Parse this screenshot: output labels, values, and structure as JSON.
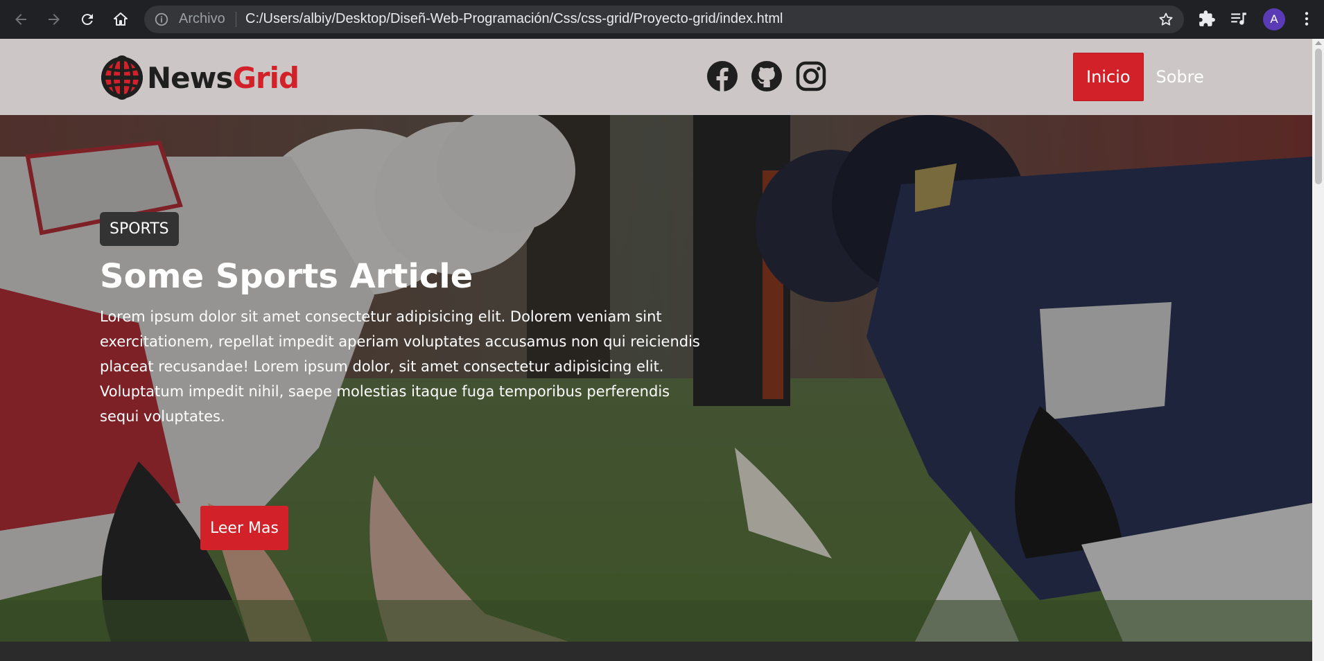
{
  "browser": {
    "scheme_label": "Archivo",
    "url": "C:/Users/albiy/Desktop/Diseñ-Web-Programación/Css/css-grid/Proyecto-grid/index.html",
    "avatar_letter": "A",
    "icons": [
      "back-icon",
      "forward-icon",
      "reload-icon",
      "home-icon",
      "info-icon",
      "bookmark-star-icon",
      "extensions-icon",
      "media-queue-icon",
      "menu-kebab-icon"
    ]
  },
  "header": {
    "logo_main": "News",
    "logo_accent": "Grid",
    "socials": [
      "facebook-icon",
      "github-icon",
      "instagram-icon"
    ],
    "nav": [
      {
        "label": "Inicio",
        "active": true
      },
      {
        "label": "Sobre",
        "active": false
      }
    ]
  },
  "hero": {
    "category": "SPORTS",
    "title": "Some Sports Article",
    "body": "Lorem ipsum dolor sit amet consectetur adipisicing elit. Dolorem veniam sint exercitationem, repellat impedit aperiam voluptates accusamus non qui reiciendis placeat recusandae! Lorem ipsum dolor, sit amet consectetur adipisicing elit. Voluptatum impedit nihil, saepe molestias itaque fuga temporibus perferendis sequi voluptates.",
    "cta": "Leer Mas"
  },
  "colors": {
    "brand_red": "#d22128",
    "header_bg": "#ccc7c6",
    "badge_bg": "#333333",
    "chrome_bg": "#202124"
  }
}
